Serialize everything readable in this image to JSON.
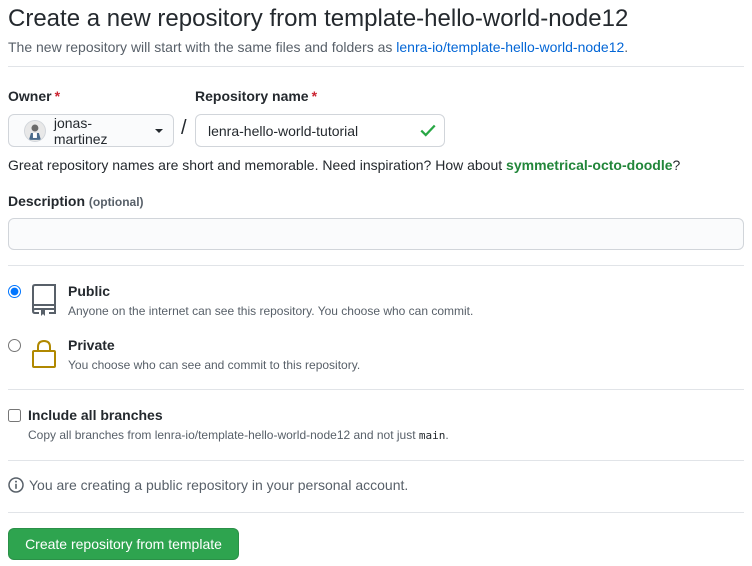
{
  "header": {
    "title": "Create a new repository from template-hello-world-node12",
    "subtitle_prefix": "The new repository will start with the same files and folders as ",
    "template_link": "lenra-io/template-hello-world-node12",
    "subtitle_suffix": "."
  },
  "owner": {
    "label": "Owner",
    "required_mark": "*",
    "value": "jonas-martinez"
  },
  "repo": {
    "label": "Repository name",
    "required_mark": "*",
    "value": "lenra-hello-world-tutorial",
    "separator": "/"
  },
  "inspiration": {
    "prefix": "Great repository names are short and memorable. Need inspiration? How about ",
    "suggestion": "symmetrical-octo-doodle",
    "suffix": "?"
  },
  "description": {
    "label": "Description",
    "optional": "(optional)",
    "value": ""
  },
  "visibility": {
    "public": {
      "title": "Public",
      "desc": "Anyone on the internet can see this repository. You choose who can commit.",
      "checked": true,
      "icon": "repo-icon"
    },
    "private": {
      "title": "Private",
      "desc": "You choose who can see and commit to this repository.",
      "checked": false,
      "icon": "lock-icon"
    }
  },
  "branches": {
    "title": "Include all branches",
    "desc_prefix": "Copy all branches from lenra-io/template-hello-world-node12 and not just ",
    "desc_code": "main",
    "desc_suffix": "."
  },
  "info": {
    "text": "You are creating a public repository in your personal account."
  },
  "submit": {
    "label": "Create repository from template"
  },
  "colors": {
    "accent_link": "#0366d6",
    "success_green": "#2ea44f",
    "suggestion_green": "#22863a",
    "required_red": "#cb2431",
    "lock_orange": "#b08800"
  }
}
